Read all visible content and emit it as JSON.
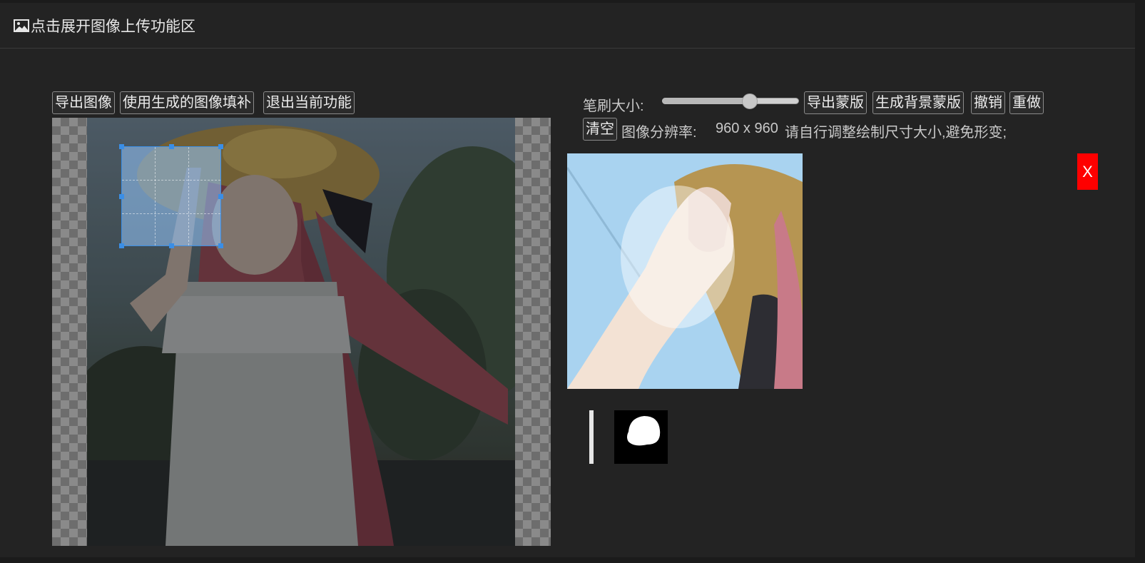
{
  "header": {
    "title": "点击展开图像上传功能区",
    "icon": "image-icon"
  },
  "left_toolbar": {
    "export_image": "导出图像",
    "fill_generated": "使用生成的图像填补",
    "exit_function": "退出当前功能"
  },
  "right_toolbar": {
    "brush_size_label": "笔刷大小:",
    "brush_size_level": 0.66,
    "export_mask": "导出蒙版",
    "generate_bg_mask": "生成背景蒙版",
    "undo": "撤销",
    "redo": "重做",
    "clear": "清空",
    "resolution_label": "图像分辨率:",
    "resolution_value": "960 x 960",
    "resolution_hint": "请自行调整绘制尺寸大小,避免形变;"
  },
  "close_label": "X",
  "colors": {
    "accent": "#3a8ee6",
    "close": "#ff0000",
    "panel": "#232323"
  }
}
